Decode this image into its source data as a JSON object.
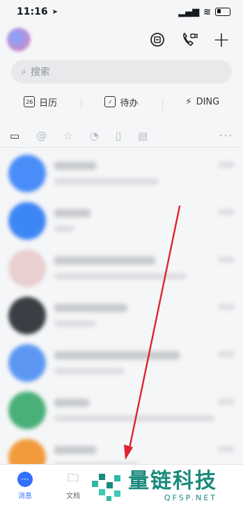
{
  "status_bar": {
    "time": "11:16",
    "location_arrow": "➤",
    "signal": "▂▄▆",
    "wifi": "≋"
  },
  "header": {
    "icons": [
      "chat-scan-icon",
      "phone-video-icon",
      "plus-icon"
    ],
    "plus_glyph": "+"
  },
  "search": {
    "placeholder": "搜索",
    "icon": "⌕"
  },
  "quick_actions": [
    {
      "label": "日历",
      "badge": "26"
    },
    {
      "label": "待办",
      "badge": "✓"
    },
    {
      "label": "DING",
      "badge": "⚡"
    }
  ],
  "filter_tabs": [
    "desktop",
    "mention",
    "star",
    "clock",
    "box",
    "doc",
    "more"
  ],
  "filter_more": "···",
  "chats": [
    {
      "avatar_color": "#4b8df8"
    },
    {
      "avatar_color": "#3d86f5"
    },
    {
      "avatar_color": "#e9cfcf"
    },
    {
      "avatar_color": "#3b3f45"
    },
    {
      "avatar_color": "#5c98f3"
    },
    {
      "avatar_color": "#4ab07a"
    },
    {
      "avatar_color": "#f29b3d"
    }
  ],
  "tabbar": {
    "messages": "消息",
    "docs": "文档"
  },
  "watermark": {
    "brand": "量链科技",
    "domain": "QFSP.NET"
  },
  "colors": {
    "accent": "#3370ff",
    "arrow": "#e0232f",
    "watermark": "#1a8a7c"
  }
}
